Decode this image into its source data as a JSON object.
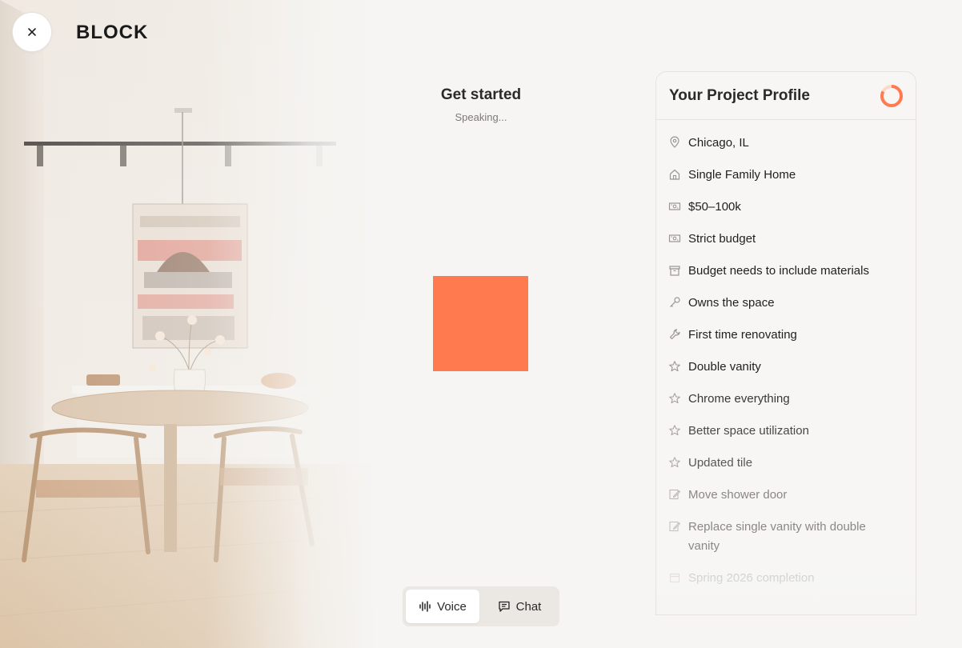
{
  "brand": {
    "logo_text": "BLOCK"
  },
  "header": {
    "close_icon": "close-icon"
  },
  "center": {
    "title": "Get started",
    "status": "Speaking...",
    "voice_color": "#ff7a4f"
  },
  "mode_toggle": {
    "voice_label": "Voice",
    "chat_label": "Chat",
    "selected": "Voice"
  },
  "profile": {
    "title": "Your Project Profile",
    "accent": "#ff7a4f",
    "items": [
      {
        "icon": "map-pin-icon",
        "label": "Chicago, IL",
        "style": "normal"
      },
      {
        "icon": "house-icon",
        "label": "Single Family Home",
        "style": "normal"
      },
      {
        "icon": "money-icon",
        "label": "$50–100k",
        "style": "normal"
      },
      {
        "icon": "money-icon",
        "label": "Strict budget",
        "style": "normal"
      },
      {
        "icon": "box-icon",
        "label": "Budget needs to include materials",
        "style": "normal"
      },
      {
        "icon": "key-icon",
        "label": "Owns the space",
        "style": "normal"
      },
      {
        "icon": "wrench-icon",
        "label": "First time renovating",
        "style": "normal"
      },
      {
        "icon": "star-icon",
        "label": "Double vanity",
        "style": "normal"
      },
      {
        "icon": "star-icon",
        "label": "Chrome everything",
        "style": "soft"
      },
      {
        "icon": "star-icon",
        "label": "Better space utilization",
        "style": "soft"
      },
      {
        "icon": "star-icon",
        "label": "Updated tile",
        "style": "soft"
      },
      {
        "icon": "pencil-icon",
        "label": "Move shower door",
        "style": "muted"
      },
      {
        "icon": "pencil-icon",
        "label": "Replace single vanity with double vanity",
        "style": "muted"
      },
      {
        "icon": "calendar-icon",
        "label": "Spring 2026 completion",
        "style": "faint"
      }
    ]
  }
}
